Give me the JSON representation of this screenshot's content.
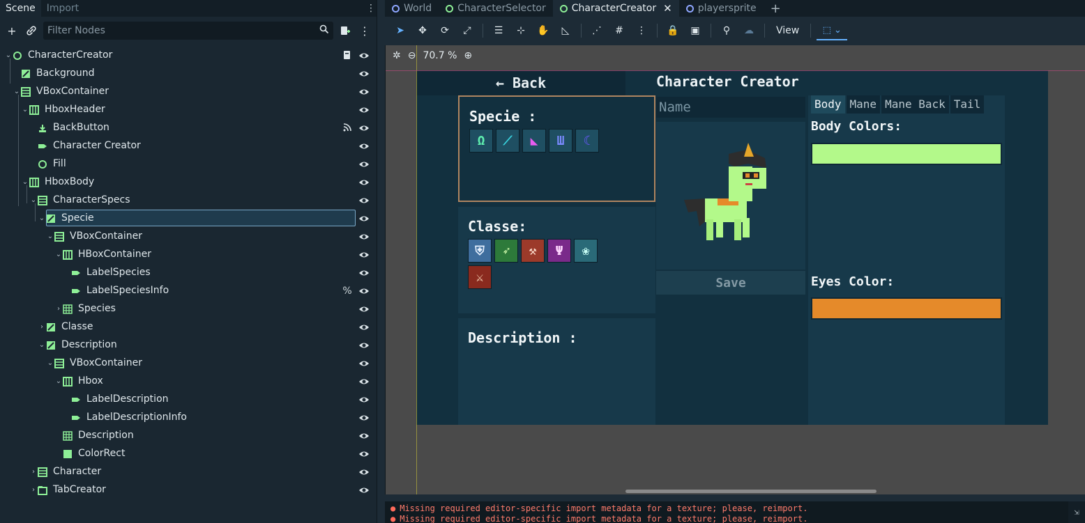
{
  "dock": {
    "tabs": [
      "Scene",
      "Import"
    ],
    "filter_placeholder": "Filter Nodes"
  },
  "tree": [
    {
      "label": "CharacterCreator",
      "icon": "node-ring-icon",
      "indent": 0,
      "expanded": true,
      "extra": "script-icon"
    },
    {
      "label": "Background",
      "icon": "texture-rect-icon",
      "indent": 1
    },
    {
      "label": "VBoxContainer",
      "icon": "vbox-icon",
      "indent": 1,
      "expanded": true
    },
    {
      "label": "HboxHeader",
      "icon": "hbox-icon",
      "indent": 2,
      "expanded": true
    },
    {
      "label": "BackButton",
      "icon": "button-icon",
      "indent": 3,
      "extra": "signal-icon"
    },
    {
      "label": "Character Creator",
      "icon": "label-icon",
      "indent": 3
    },
    {
      "label": "Fill",
      "icon": "control-ring-icon",
      "indent": 3
    },
    {
      "label": "HboxBody",
      "icon": "hbox-icon",
      "indent": 2,
      "expanded": true
    },
    {
      "label": "CharacterSpecs",
      "icon": "vbox-icon",
      "indent": 3,
      "expanded": true
    },
    {
      "label": "Specie",
      "icon": "panel-icon",
      "indent": 4,
      "expanded": true,
      "selected": true
    },
    {
      "label": "VBoxContainer",
      "icon": "vbox-icon",
      "indent": 5,
      "expanded": true
    },
    {
      "label": "HBoxContainer",
      "icon": "hbox-icon",
      "indent": 6,
      "expanded": true
    },
    {
      "label": "LabelSpecies",
      "icon": "label-icon",
      "indent": 7
    },
    {
      "label": "LabelSpeciesInfo",
      "icon": "label-icon",
      "indent": 7,
      "extra_text": "%"
    },
    {
      "label": "Species",
      "icon": "grid-icon",
      "indent": 6,
      "collapsed": true
    },
    {
      "label": "Classe",
      "icon": "panel-icon",
      "indent": 4,
      "collapsed": true
    },
    {
      "label": "Description",
      "icon": "panel-icon",
      "indent": 4,
      "expanded": true
    },
    {
      "label": "VBoxContainer",
      "icon": "vbox-icon",
      "indent": 5,
      "expanded": true
    },
    {
      "label": "Hbox",
      "icon": "hbox-icon",
      "indent": 6,
      "expanded": true
    },
    {
      "label": "LabelDescription",
      "icon": "label-icon",
      "indent": 7
    },
    {
      "label": "LabelDescriptionInfo",
      "icon": "label-icon",
      "indent": 7
    },
    {
      "label": "Description",
      "icon": "grid-icon",
      "indent": 6
    },
    {
      "label": "ColorRect",
      "icon": "color-rect-icon",
      "indent": 6
    },
    {
      "label": "Character",
      "icon": "vbox-icon",
      "indent": 3,
      "collapsed": true
    },
    {
      "label": "TabCreator",
      "icon": "tab-container-icon",
      "indent": 3,
      "collapsed": true
    }
  ],
  "editor_tabs": [
    {
      "label": "World",
      "ring": "blue"
    },
    {
      "label": "CharacterSelector",
      "ring": "green"
    },
    {
      "label": "CharacterCreator",
      "ring": "green",
      "active": true
    },
    {
      "label": "playersprite",
      "ring": "blue"
    }
  ],
  "toolbar": {
    "view_label": "View"
  },
  "viewport": {
    "zoom": "70.7 %"
  },
  "game": {
    "back_label": "← Back",
    "title": "Character Creator",
    "specie_title": "Specie :",
    "classe_title": "Classe:",
    "description_title": "Description :",
    "name_placeholder": "Name",
    "save_label": "Save",
    "tabs": [
      "Body",
      "Mane",
      "Mane Back",
      "Tail"
    ],
    "body_colors_label": "Body Colors:",
    "eyes_color_label": "Eyes Color:",
    "body_color": "#b3f98a",
    "eyes_color": "#e58a2a",
    "specie_icons": [
      {
        "name": "horseshoe-icon",
        "color": "#5ff0b0",
        "glyph": "Ω"
      },
      {
        "name": "feather-icon",
        "color": "#39d5e0",
        "glyph": "⟋"
      },
      {
        "name": "horn-icon",
        "color": "#e85cf0",
        "glyph": "◣"
      },
      {
        "name": "claw-icon",
        "color": "#7a8bff",
        "glyph": "Ш"
      },
      {
        "name": "moon-icon",
        "color": "#6a58ff",
        "glyph": "☾"
      }
    ],
    "classe_icons": [
      {
        "name": "shield-icon",
        "color": "#e7f1ff",
        "bg": "#3f6e9e",
        "glyph": "⛨"
      },
      {
        "name": "arrow-icon",
        "color": "#d6ffb0",
        "bg": "#2d7a3a",
        "glyph": "➶"
      },
      {
        "name": "axe-icon",
        "color": "#ffe0d0",
        "bg": "#9c3a2a",
        "glyph": "⚒"
      },
      {
        "name": "trident-icon",
        "color": "#ffd6ff",
        "bg": "#7a2a8a",
        "glyph": "Ψ"
      },
      {
        "name": "rose-icon",
        "color": "#c8fff6",
        "bg": "#2a6a78",
        "glyph": "❀"
      },
      {
        "name": "crossed-swords-icon",
        "color": "#ffe0c0",
        "bg": "#8a2a1e",
        "glyph": "⚔"
      }
    ]
  },
  "output": [
    "Missing required editor-specific import metadata for a texture; please, reimport.",
    "Missing required editor-specific import metadata for a texture; please, reimport."
  ]
}
